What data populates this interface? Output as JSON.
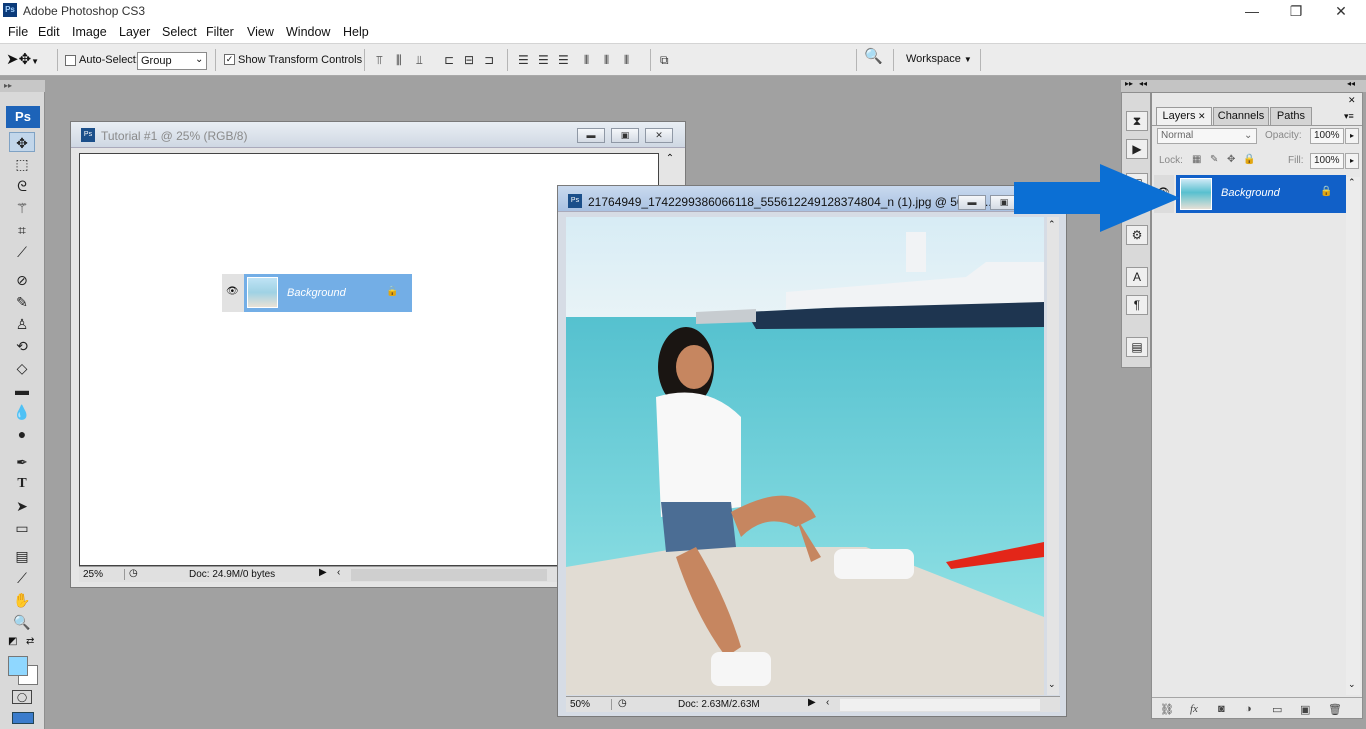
{
  "app": {
    "badge": "Ps",
    "title": "Adobe Photoshop CS3"
  },
  "window_controls": {
    "minimize": "—",
    "restore": "❐",
    "close": "✕"
  },
  "menu": [
    "File",
    "Edit",
    "Image",
    "Layer",
    "Select",
    "Filter",
    "View",
    "Window",
    "Help"
  ],
  "options_bar": {
    "auto_select_label": "Auto-Select:",
    "auto_select_checked": false,
    "auto_select_value": "Group",
    "show_transform_label": "Show Transform Controls",
    "show_transform_checked": true,
    "workspace_label": "Workspace"
  },
  "toolbox": {
    "badge": "Ps",
    "foreground_color": "#8fd7ff",
    "background_color": "#ffffff"
  },
  "doc1": {
    "title": "Tutorial #1 @ 25% (RGB/8)",
    "zoom": "25%",
    "doc_info": "Doc: 24.9M/0 bytes",
    "layer_name": "Background"
  },
  "doc2": {
    "title": "21764949_1742299386066118_555612249128374804_n (1).jpg @ 50% (...",
    "zoom": "50%",
    "doc_info": "Doc: 2.63M/2.63M"
  },
  "layers_panel": {
    "tabs": [
      "Layers",
      "Channels",
      "Paths"
    ],
    "blend_mode": "Normal",
    "opacity_label": "Opacity:",
    "opacity_value": "100%",
    "lock_label": "Lock:",
    "fill_label": "Fill:",
    "fill_value": "100%",
    "layer_name": "Background"
  },
  "colors": {
    "accent_arrow": "#0b6fd4",
    "layer_selected": "#1160c8"
  }
}
